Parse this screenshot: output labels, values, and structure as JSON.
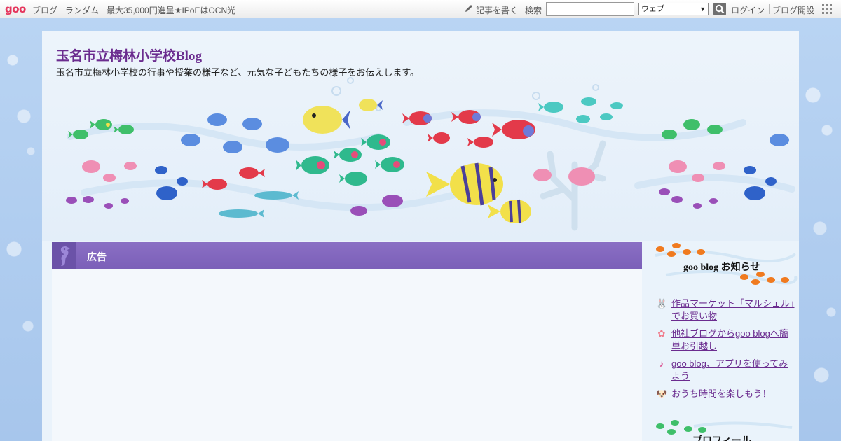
{
  "toolbar": {
    "logo": "goo",
    "links": [
      "ブログ",
      "ランダム",
      "最大35,000円進呈★IPoEはOCN光"
    ],
    "write_label": "記事を書く",
    "search_label": "検索",
    "search_value": "",
    "search_scope": "ウェブ",
    "login_label": "ログイン",
    "open_blog_label": "ブログ開設"
  },
  "blog": {
    "title": "玉名市立梅林小学校Blog",
    "description": "玉名市立梅林小学校の行事や授業の様子など、元気な子どもたちの様子をお伝えします。"
  },
  "main": {
    "ad_heading": "広告"
  },
  "sidebar": {
    "notice_title": "goo blog お知らせ",
    "notices": [
      {
        "icon": "rabbit-icon",
        "text": "作品マーケット「マルシェル」でお買い物"
      },
      {
        "icon": "flower-icon",
        "text": "他社ブログからgoo blogへ簡単お引越し"
      },
      {
        "icon": "music-note-icon",
        "text": "goo blog、アプリを使ってみよう"
      },
      {
        "icon": "dog-icon",
        "text": "おうち時間を楽しもう！"
      }
    ],
    "profile_title": "プロフィール"
  },
  "colors": {
    "accent": "#6b2c8f",
    "ad_bar": "#7b5fb8",
    "background": "#a9c9ee"
  }
}
